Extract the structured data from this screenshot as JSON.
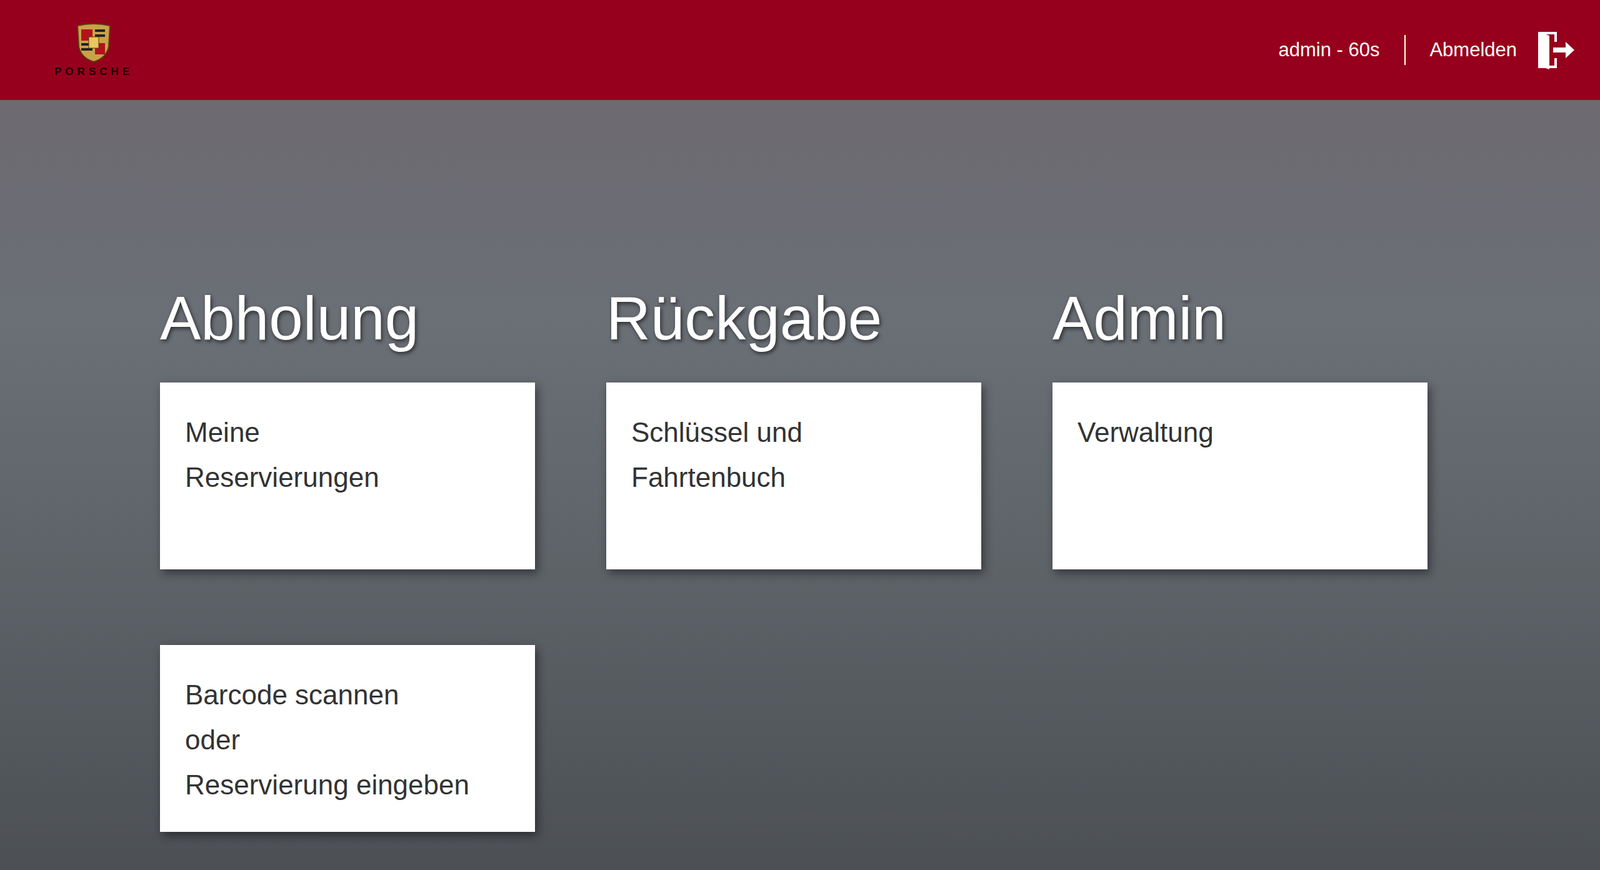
{
  "header": {
    "logo_text": "PORSCHE",
    "user": "admin - 60s",
    "logout": "Abmelden"
  },
  "sections": [
    {
      "title": "Abholung",
      "cards": [
        {
          "lines": [
            "Meine",
            "Reservierungen"
          ]
        },
        {
          "lines": [
            "Barcode scannen",
            "oder",
            "Reservierung eingeben"
          ]
        }
      ]
    },
    {
      "title": "Rückgabe",
      "cards": [
        {
          "lines": [
            "Schlüssel und",
            "Fahrtenbuch"
          ]
        }
      ]
    },
    {
      "title": "Admin",
      "cards": [
        {
          "lines": [
            "Verwaltung"
          ]
        }
      ]
    }
  ]
}
